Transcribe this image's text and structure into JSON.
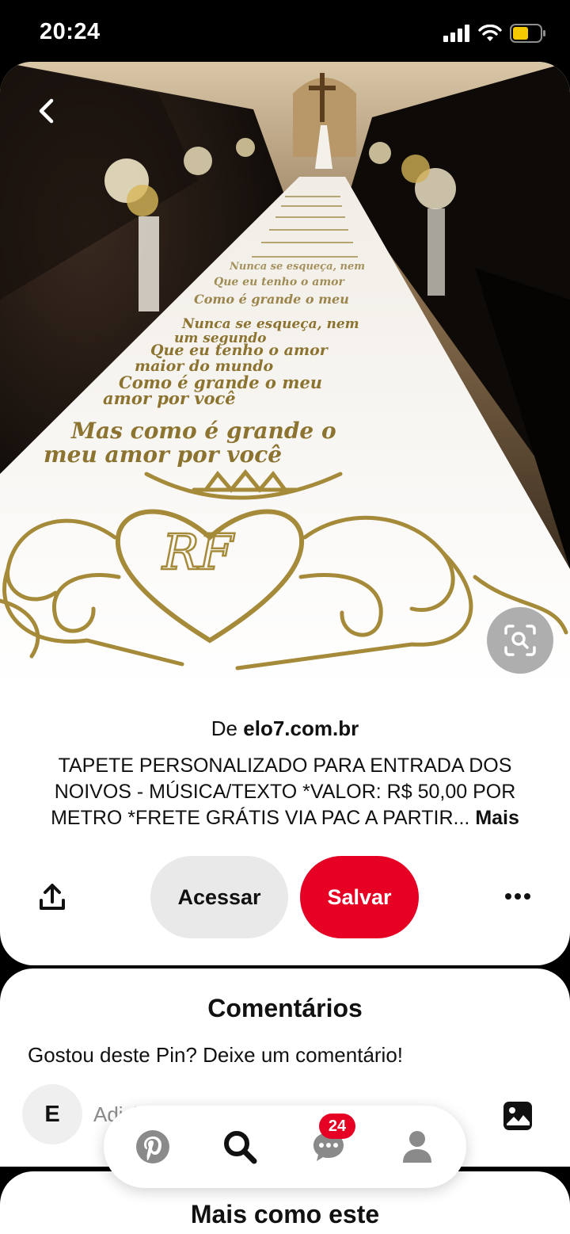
{
  "status_bar": {
    "time": "20:24"
  },
  "pin": {
    "source_prefix": "De",
    "source_domain": "elo7.com.br",
    "description": "TAPETE PERSONALIZADO PARA ENTRADA DOS NOIVOS - MÚSICA/TEXTO *VALOR: R$ 50,00 POR METRO *FRETE GRÁTIS VIA PAC A PARTIR...",
    "more_link": "Mais",
    "carpet_text": {
      "line1": "Mas como é grande o",
      "line2": "meu amor por você",
      "monogram": "RF",
      "verse": [
        "Nunca se esqueça, nem",
        "um segundo",
        "Que eu tenho o amor",
        "maior do mundo",
        "Como é grande o meu",
        "amor por você"
      ]
    }
  },
  "actions": {
    "visit_label": "Acessar",
    "save_label": "Salvar"
  },
  "comments": {
    "title": "Comentários",
    "prompt": "Gostou deste Pin? Deixe um comentário!",
    "avatar_initial": "E",
    "input_placeholder": "Adicionar um comentário"
  },
  "more_like_this": {
    "title": "Mais como este"
  },
  "nav": {
    "items": [
      {
        "icon": "pinterest-logo-icon"
      },
      {
        "icon": "search-icon"
      },
      {
        "icon": "messages-icon",
        "badge": "24"
      },
      {
        "icon": "profile-icon"
      }
    ]
  },
  "colors": {
    "accent": "#e60023",
    "gold": "#a58a3a"
  }
}
